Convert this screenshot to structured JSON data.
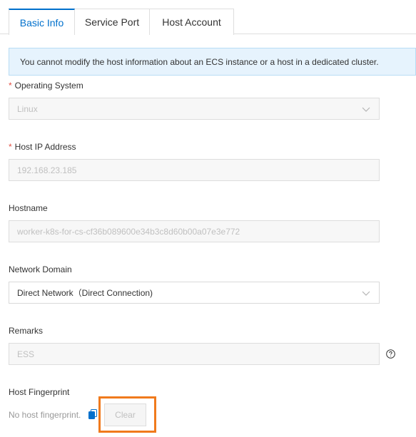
{
  "tabs": [
    {
      "label": "Basic Info",
      "active": true
    },
    {
      "label": "Service Port",
      "active": false
    },
    {
      "label": "Host Account",
      "active": false
    }
  ],
  "alert": {
    "text": "You cannot modify the host information about an ECS instance or a host in a dedicated cluster."
  },
  "form": {
    "os": {
      "label": "Operating System",
      "required_mark": "*",
      "value": "Linux",
      "disabled": true
    },
    "ip": {
      "label": "Host IP Address",
      "required_mark": "*",
      "value": "192.168.23.185",
      "disabled": true
    },
    "hostname": {
      "label": "Hostname",
      "value": "worker-k8s-for-cs-cf36b089600e34b3c8d60b00a07e3e772",
      "disabled": true
    },
    "network": {
      "label": "Network Domain",
      "value": "Direct Network（Direct Connection)",
      "disabled": false
    },
    "remarks": {
      "label": "Remarks",
      "value": "ESS",
      "disabled": true
    },
    "fingerprint": {
      "label": "Host Fingerprint",
      "value": "No host fingerprint.",
      "clear_label": "Clear"
    }
  },
  "colors": {
    "accent": "#0070cc",
    "required": "#e34e43",
    "highlight": "#f07a1c",
    "alert_bg": "#e6f3fd"
  }
}
